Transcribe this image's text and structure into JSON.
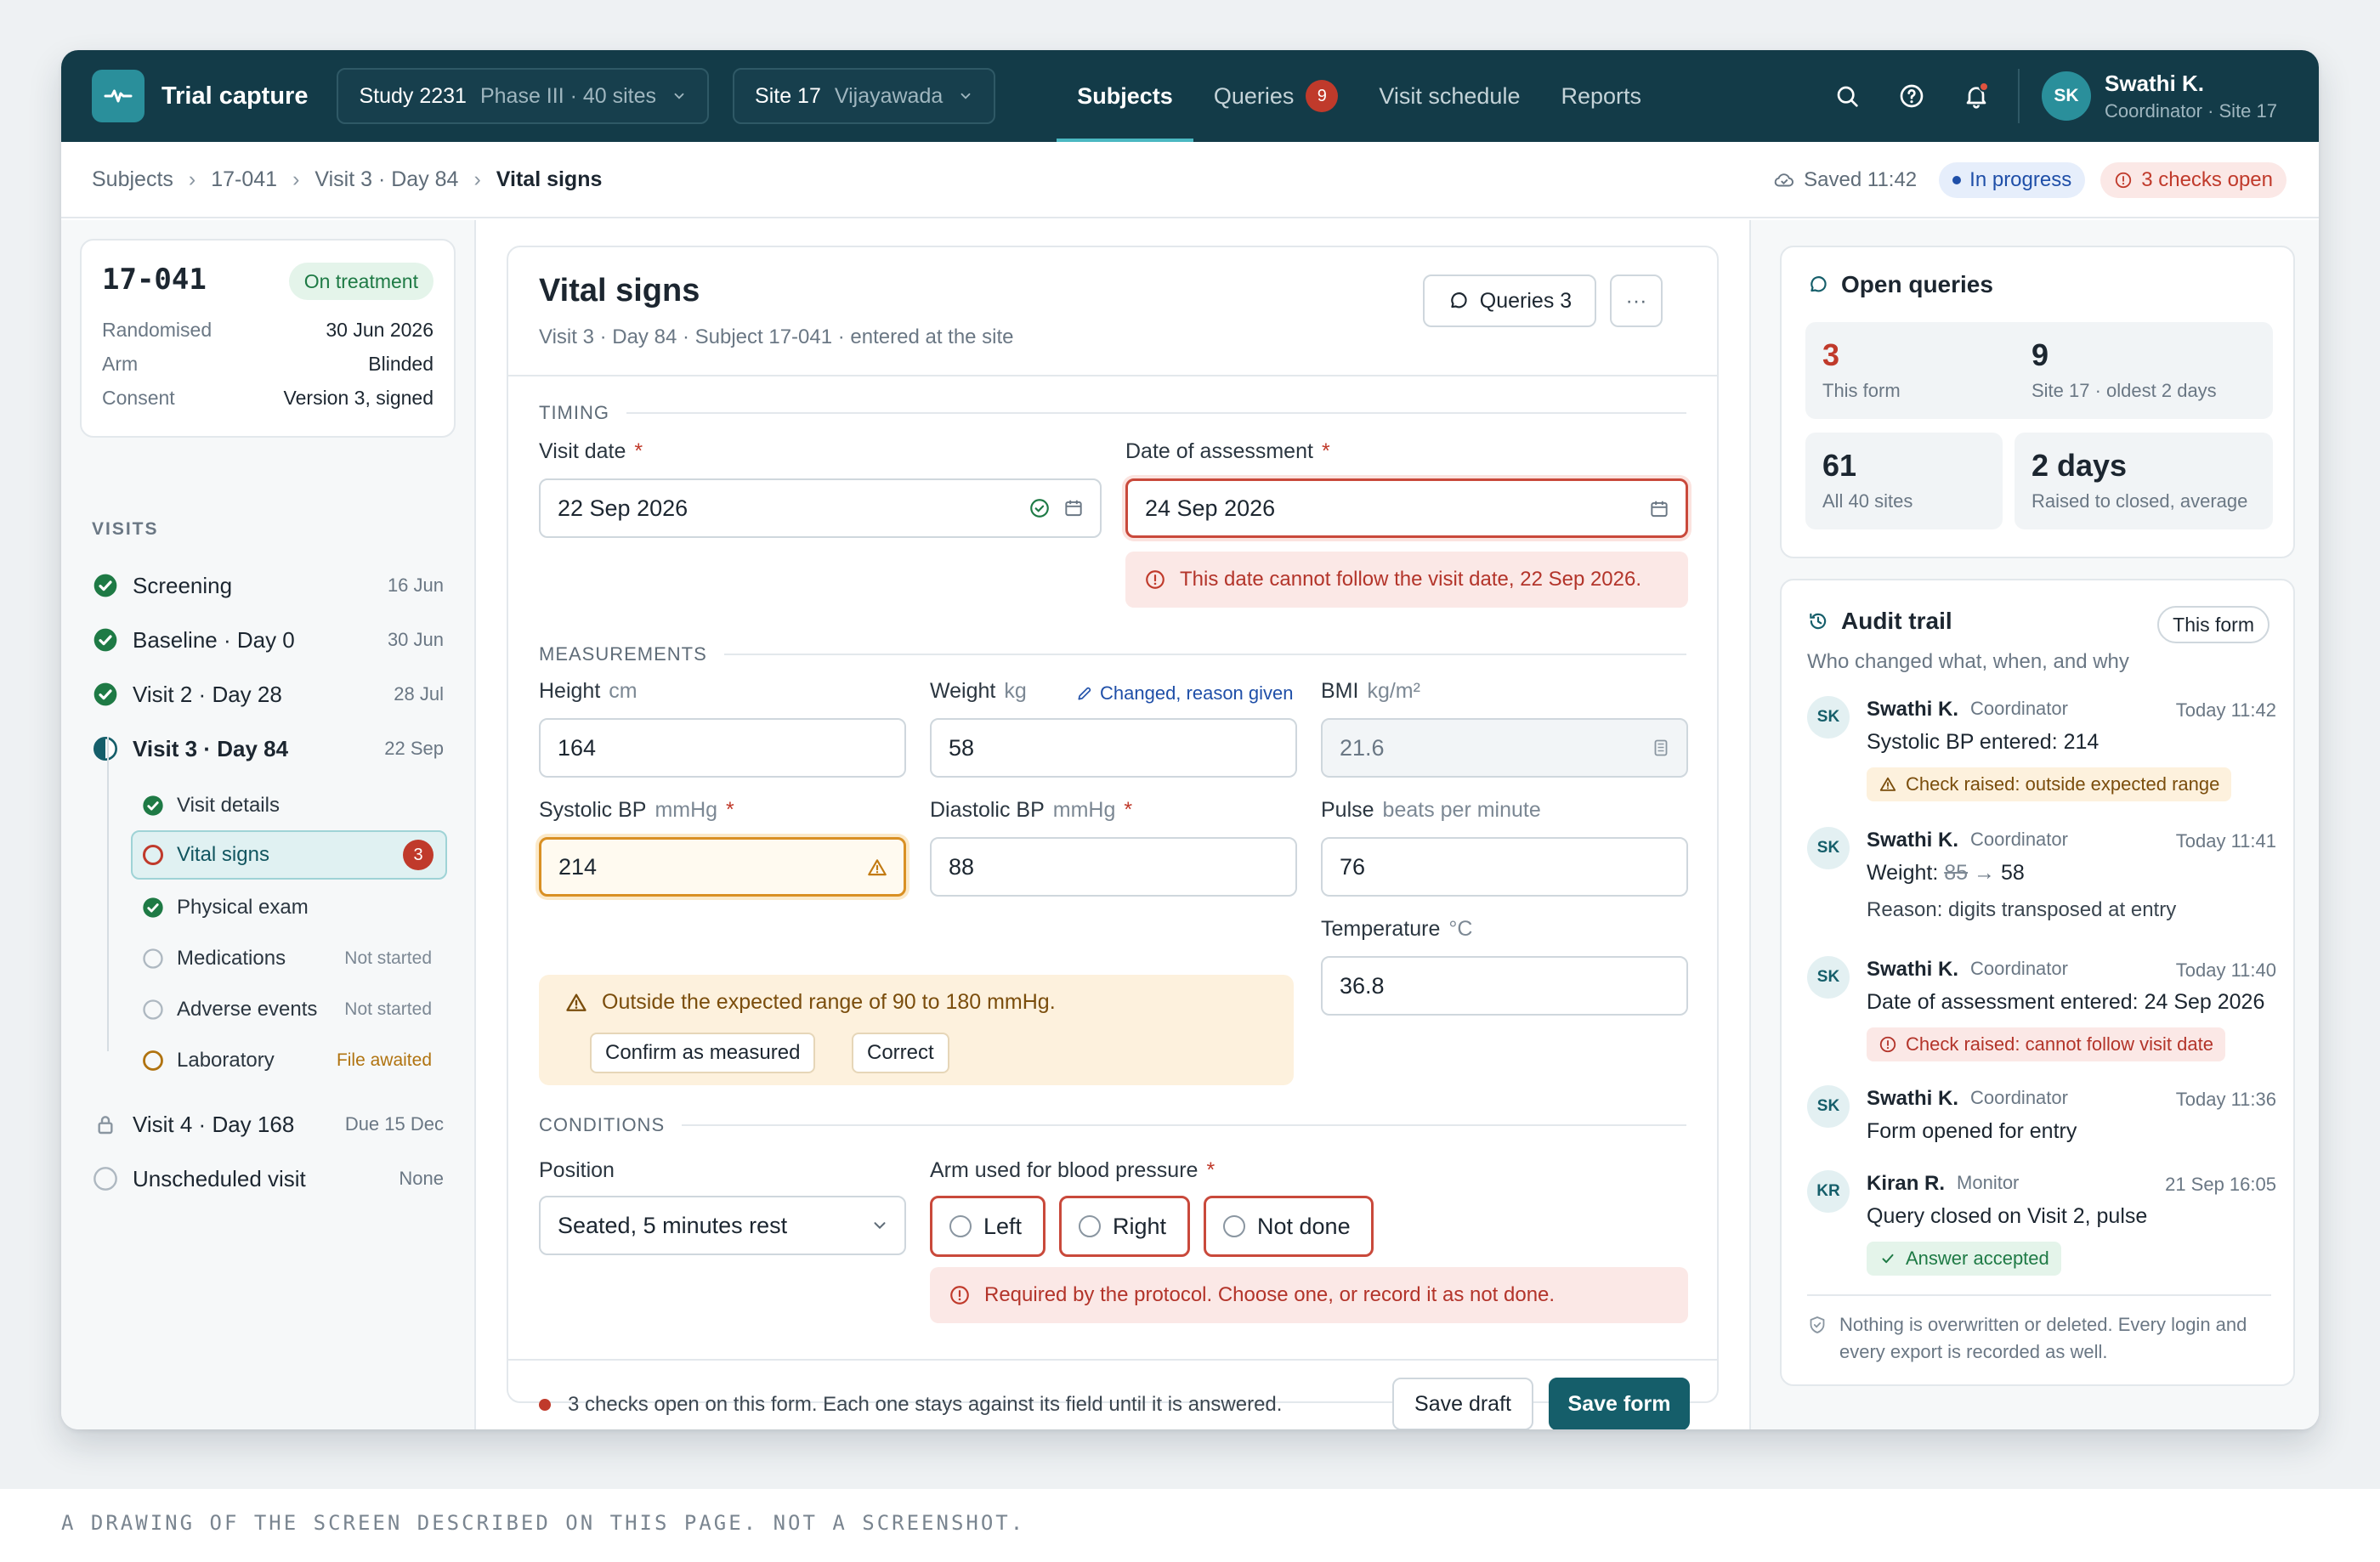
{
  "app": {
    "name": "Trial capture"
  },
  "header": {
    "study_picker": {
      "main": "Study 2231",
      "sub": "Phase III · 40 sites"
    },
    "site_picker": {
      "main": "Site 17",
      "sub": "Vijayawada"
    },
    "nav": [
      {
        "label": "Subjects",
        "active": true
      },
      {
        "label": "Queries",
        "badge": "9"
      },
      {
        "label": "Visit schedule"
      },
      {
        "label": "Reports"
      }
    ],
    "user": {
      "initials": "SK",
      "name": "Swathi K.",
      "role": "Coordinator · Site 17"
    },
    "icons": [
      "search-icon",
      "help-icon",
      "bell-icon"
    ]
  },
  "breadcrumb": {
    "items": [
      "Subjects",
      "17-041",
      "Visit 3 · Day 84"
    ],
    "current": "Vital signs",
    "saved": "Saved 11:42",
    "status": "In progress",
    "checks": "3 checks open"
  },
  "subject": {
    "id": "17-041",
    "status": "On treatment",
    "fields": [
      {
        "k": "Randomised",
        "v": "30 Jun 2026"
      },
      {
        "k": "Arm",
        "v": "Blinded"
      },
      {
        "k": "Consent",
        "v": "Version 3, signed"
      }
    ]
  },
  "visits": {
    "title": "VISITS",
    "items": [
      {
        "label": "Screening",
        "date": "16 Jun",
        "state": "done"
      },
      {
        "label": "Baseline · Day 0",
        "date": "30 Jun",
        "state": "done"
      },
      {
        "label": "Visit 2 · Day 28",
        "date": "28 Jul",
        "state": "done"
      },
      {
        "label": "Visit 3 · Day 84",
        "date": "22 Sep",
        "state": "partial"
      },
      {
        "label": "Visit 4 · Day 168",
        "date": "Due 15 Dec",
        "state": "locked"
      },
      {
        "label": "Unscheduled visit",
        "date": "None",
        "state": "empty"
      }
    ],
    "sub": [
      {
        "label": "Visit details",
        "date": "",
        "state": "done"
      },
      {
        "label": "Vital signs",
        "date": "",
        "state": "error",
        "badge": "3"
      },
      {
        "label": "Physical exam",
        "date": "",
        "state": "done"
      },
      {
        "label": "Medications",
        "date": "Not started",
        "state": "empty"
      },
      {
        "label": "Adverse events",
        "date": "Not started",
        "state": "empty"
      },
      {
        "label": "Laboratory",
        "date": "File awaited",
        "state": "pending"
      }
    ]
  },
  "form": {
    "title": "Vital signs",
    "subtitle": "Visit 3 · Day 84 · Subject 17-041 · entered at the site",
    "queries_btn": "Queries 3",
    "more_btn": "···",
    "sections": {
      "timing": "TIMING",
      "measurements": "MEASUREMENTS",
      "conditions": "CONDITIONS"
    },
    "visit_date": {
      "label": "Visit date",
      "value": "22 Sep 2026"
    },
    "assessment_date": {
      "label": "Date of assessment",
      "value": "24 Sep 2026",
      "error": "This date cannot follow the visit date, 22 Sep 2026."
    },
    "height": {
      "label": "Height",
      "unit": "cm",
      "value": "164"
    },
    "weight": {
      "label": "Weight",
      "unit": "kg",
      "value": "58",
      "note": "Changed, reason given"
    },
    "bmi": {
      "label": "BMI",
      "unit": "kg/m²",
      "value": "21.6"
    },
    "systolic": {
      "label": "Systolic BP",
      "unit": "mmHg",
      "value": "214"
    },
    "diastolic": {
      "label": "Diastolic BP",
      "unit": "mmHg",
      "value": "88"
    },
    "pulse": {
      "label": "Pulse",
      "unit": "beats per minute",
      "value": "76"
    },
    "temperature": {
      "label": "Temperature",
      "unit": "°C",
      "value": "36.8"
    },
    "range_warning": {
      "text": "Outside the expected range of 90 to 180 mmHg.",
      "confirm": "Confirm as measured",
      "correct": "Correct"
    },
    "position": {
      "label": "Position",
      "value": "Seated, 5 minutes rest"
    },
    "arm": {
      "label": "Arm used for blood pressure",
      "options": [
        "Left",
        "Right",
        "Not done"
      ],
      "error": "Required by the protocol. Choose one, or record it as not done."
    },
    "footer_note": "3 checks open on this form. Each one stays against its field until it is answered.",
    "save_draft": "Save draft",
    "save_form": "Save form",
    "required_mark": "*"
  },
  "open_queries": {
    "title": "Open queries",
    "stats": [
      {
        "value": "3",
        "label": "This form",
        "highlight": true
      },
      {
        "value": "9",
        "label": "Site 17 · oldest 2 days"
      },
      {
        "value": "61",
        "label": "All 40 sites"
      },
      {
        "value": "2 days",
        "label": "Raised to closed, average"
      }
    ]
  },
  "audit": {
    "title": "Audit trail",
    "filter": "This form",
    "subtitle": "Who changed what, when, and why",
    "entries": [
      {
        "initials": "SK",
        "name": "Swathi K.",
        "role": "Coordinator",
        "time": "Today 11:42",
        "line": "Systolic BP entered: 214",
        "tag": "Check raised: outside expected range"
      },
      {
        "initials": "SK",
        "name": "Swathi K.",
        "role": "Coordinator",
        "time": "Today 11:41",
        "line_prefix": "Weight: ",
        "old": "85",
        "arrow": "→",
        "new": "58",
        "reason": "Reason: digits transposed at entry"
      },
      {
        "initials": "SK",
        "name": "Swathi K.",
        "role": "Coordinator",
        "time": "Today 11:40",
        "line": "Date of assessment entered: 24 Sep 2026",
        "tag": "Check raised: cannot follow visit date"
      },
      {
        "initials": "SK",
        "name": "Swathi K.",
        "role": "Coordinator",
        "time": "Today 11:36",
        "line": "Form opened for entry"
      },
      {
        "initials": "KR",
        "name": "Kiran R.",
        "role": "Monitor",
        "time": "21 Sep 16:05",
        "line": "Query closed on Visit 2, pulse",
        "tag": "Answer accepted"
      }
    ],
    "footer": "Nothing is overwritten or deleted. Every login and every export is recorded as well."
  },
  "caption": "A DRAWING OF THE SCREEN DESCRIBED ON THIS PAGE. NOT A SCREENSHOT.",
  "colors": {
    "brand": "#133b48",
    "accent": "#155e6a",
    "error": "#c03a2b",
    "warning": "#d99024",
    "success": "#1e7a45"
  }
}
